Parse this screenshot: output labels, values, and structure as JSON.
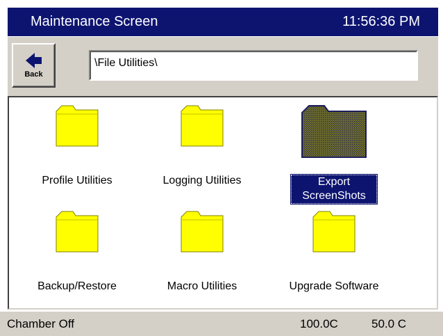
{
  "title_bar": {
    "title": "Maintenance Screen",
    "time": "11:56:36 PM"
  },
  "toolbar": {
    "back_label": "Back",
    "path_value": "\\File Utilities\\"
  },
  "folders": [
    {
      "label": "Profile Utilities",
      "selected": false
    },
    {
      "label": "Logging Utilities",
      "selected": false
    },
    {
      "label": "Export ScreenShots",
      "selected": true
    },
    {
      "label": "Backup/Restore",
      "selected": false
    },
    {
      "label": "Macro Utilities",
      "selected": false
    },
    {
      "label": "Upgrade Software",
      "selected": false
    }
  ],
  "status_bar": {
    "chamber_status": "Chamber Off",
    "reading_1": "100.0C",
    "reading_2": "50.0 C"
  },
  "colors": {
    "title_bg": "#0d1470",
    "folder_yellow": "#ffff00",
    "selection": "#0d1470",
    "chrome": "#d4d0c8"
  },
  "icons": {
    "back": "left-arrow-icon",
    "folder": "folder-icon"
  }
}
